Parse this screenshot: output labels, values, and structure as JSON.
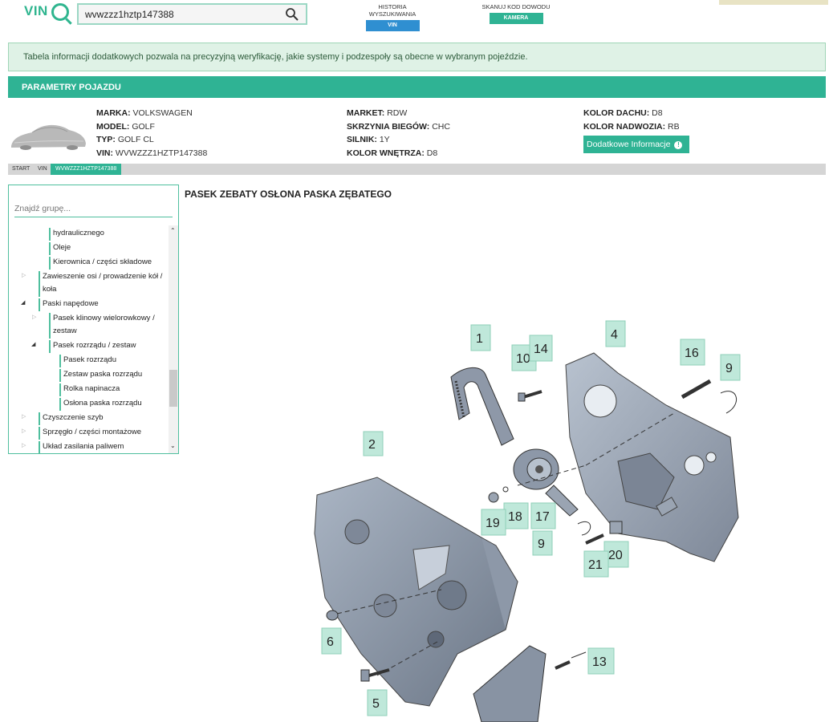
{
  "header": {
    "logo_text": "VIN",
    "search_value": "wvwzzz1hztp147388",
    "history_label": "HISTORIA WYSZUKIWANIA",
    "history_button": "VIN",
    "scan_label": "SKANUJ KOD DOWODU",
    "scan_button": "KAMERA",
    "accent_color": "#2fb394",
    "vin_button_color": "#2f8fd1"
  },
  "info_banner": "Tabela informacji dodatkowych pozwala na precyzyjną weryfikację, jakie systemy i podzespoły są obecne w wybranym pojeździe.",
  "params_title": "PARAMETRY POJAZDU",
  "vehicle": {
    "marka_label": "MARKA:",
    "marka": "VOLKSWAGEN",
    "model_label": "MODEL:",
    "model": "GOLF",
    "typ_label": "TYP:",
    "typ": "GOLF CL",
    "vin_label": "VIN:",
    "vin": "WVWZZZ1HZTP147388",
    "market_label": "MARKET:",
    "market": "RDW",
    "skrzynia_label": "SKRZYNIA BIEGÓW:",
    "skrzynia": "CHC",
    "silnik_label": "SILNIK:",
    "silnik": "1Y",
    "wnetrze_label": "KOLOR WNĘTRZA:",
    "wnetrze": "D8",
    "dach_label": "KOLOR DACHU:",
    "dach": "D8",
    "nadwozie_label": "KOLOR NADWOZIA:",
    "nadwozie": "RB",
    "extra_button": "Dodatkowe Informacje"
  },
  "breadcrumb": [
    "START",
    "VIN",
    "WVWZZZ1HZTP147388"
  ],
  "sidebar": {
    "search_placeholder": "Znajdź grupę...",
    "items": [
      {
        "label": "hydraulicznego"
      },
      {
        "label": "Oleje"
      },
      {
        "label": "Kierownica / części składowe"
      },
      {
        "label": "Zawieszenie osi / prowadzenie kół /"
      },
      {
        "label": "koła"
      },
      {
        "label": "Paski napędowe"
      },
      {
        "label": "Pasek klinowy wielorowkowy /"
      },
      {
        "label": "zestaw"
      },
      {
        "label": "Pasek rozrządu / zestaw"
      },
      {
        "label": "Pasek rozrządu"
      },
      {
        "label": "Zestaw paska rozrządu"
      },
      {
        "label": "Rolka napinacza"
      },
      {
        "label": "Osłona paska rozrządu"
      },
      {
        "label": "Czyszczenie szyb"
      },
      {
        "label": "Sprzęgło / części montażowe"
      },
      {
        "label": "Układ zasilania paliwem"
      }
    ]
  },
  "diagram": {
    "title": "PASEK ZEBATY OSŁONA PASKA ZĘBATEGO",
    "callouts": [
      "1",
      "2",
      "4",
      "5",
      "6",
      "9",
      "9",
      "10",
      "13",
      "14",
      "16",
      "17",
      "18",
      "19",
      "20",
      "21"
    ]
  }
}
